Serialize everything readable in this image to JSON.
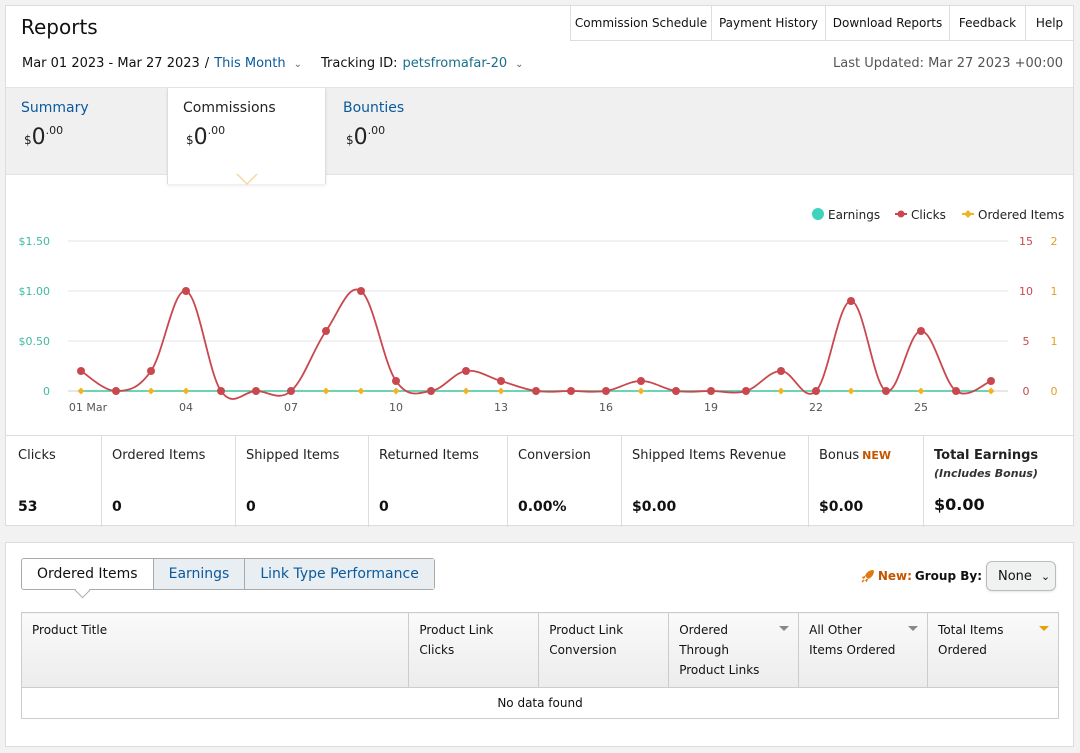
{
  "header": {
    "title": "Reports",
    "nav": [
      "Commission Schedule",
      "Payment History",
      "Download Reports",
      "Feedback",
      "Help"
    ],
    "date_range": "Mar 01 2023 - Mar 27 2023",
    "separator": "/",
    "period": "This Month",
    "tracking_label": "Tracking ID:",
    "tracking_id": "petsfromafar-20",
    "last_updated": "Last Updated: Mar 27 2023 +00:00"
  },
  "summary_tabs": [
    {
      "label": "Summary",
      "currency": "$",
      "whole": "0",
      "cents": ".00"
    },
    {
      "label": "Commissions",
      "currency": "$",
      "whole": "0",
      "cents": ".00"
    },
    {
      "label": "Bounties",
      "currency": "$",
      "whole": "0",
      "cents": ".00"
    }
  ],
  "chart_data": {
    "type": "line",
    "legend": [
      "Earnings",
      "Clicks",
      "Ordered Items"
    ],
    "legend_placement": "top-right",
    "x": [
      1,
      2,
      3,
      4,
      5,
      6,
      7,
      8,
      9,
      10,
      11,
      12,
      13,
      14,
      15,
      16,
      17,
      18,
      19,
      20,
      21,
      22,
      23,
      24,
      25,
      26,
      27
    ],
    "x_tick_labels": [
      "01 Mar",
      "04",
      "07",
      "10",
      "13",
      "16",
      "19",
      "22",
      "25"
    ],
    "series": [
      {
        "name": "Earnings",
        "color": "#3fd3bd",
        "axis": "left",
        "values": [
          0,
          0,
          0,
          0,
          0,
          0,
          0,
          0,
          0,
          0,
          0,
          0,
          0,
          0,
          0,
          0,
          0,
          0,
          0,
          0,
          0,
          0,
          0,
          0,
          0,
          0,
          0
        ]
      },
      {
        "name": "Clicks",
        "color": "#c9484f",
        "axis": "right1",
        "values": [
          2,
          0,
          2,
          10,
          0,
          0,
          0,
          6,
          10,
          1,
          0,
          2,
          1,
          0,
          0,
          0,
          1,
          0,
          0,
          0,
          2,
          0,
          9,
          0,
          6,
          0,
          1
        ]
      },
      {
        "name": "Ordered Items",
        "color": "#f0b429",
        "axis": "right2",
        "values": [
          0,
          0,
          0,
          0,
          0,
          0,
          0,
          0,
          0,
          0,
          0,
          0,
          0,
          0,
          0,
          0,
          0,
          0,
          0,
          0,
          0,
          0,
          0,
          0,
          0,
          0,
          0
        ]
      }
    ],
    "y_left_ticks": [
      "$1.50",
      "$1.00",
      "$0.50",
      "0"
    ],
    "y_left_range": [
      0,
      1.5
    ],
    "y_right1_ticks": [
      "15",
      "10",
      "5",
      "0"
    ],
    "y_right1_range": [
      0,
      15
    ],
    "y_right2_ticks": [
      "2",
      "1",
      "1",
      "0"
    ],
    "y_right2_range": [
      0,
      2
    ],
    "grid": true
  },
  "stats": [
    {
      "label": "Clicks",
      "value": "53"
    },
    {
      "label": "Ordered Items",
      "value": "0"
    },
    {
      "label": "Shipped Items",
      "value": "0"
    },
    {
      "label": "Returned Items",
      "value": "0"
    },
    {
      "label": "Conversion",
      "value": "0.00%"
    },
    {
      "label": "Shipped Items Revenue",
      "value": "$0.00"
    },
    {
      "label": "Bonus",
      "badge": "NEW",
      "value": "$0.00"
    },
    {
      "label": "Total Earnings",
      "sub": "(Includes Bonus)",
      "value": "$0.00"
    }
  ],
  "bottom": {
    "tabs": [
      "Ordered Items",
      "Earnings",
      "Link Type Performance"
    ],
    "new_label": "New:",
    "group_by_label": "Group By:",
    "group_by_value": "None",
    "columns": [
      {
        "label": "Product Title"
      },
      {
        "label": "Product Link Clicks"
      },
      {
        "label": "Product Link Conversion"
      },
      {
        "label": "Ordered Through Product Links",
        "sortable": true
      },
      {
        "label": "All Other Items Ordered",
        "sortable": true
      },
      {
        "label": "Total Items Ordered",
        "sortable": true,
        "sort_active": true
      }
    ],
    "empty_text": "No data found"
  }
}
